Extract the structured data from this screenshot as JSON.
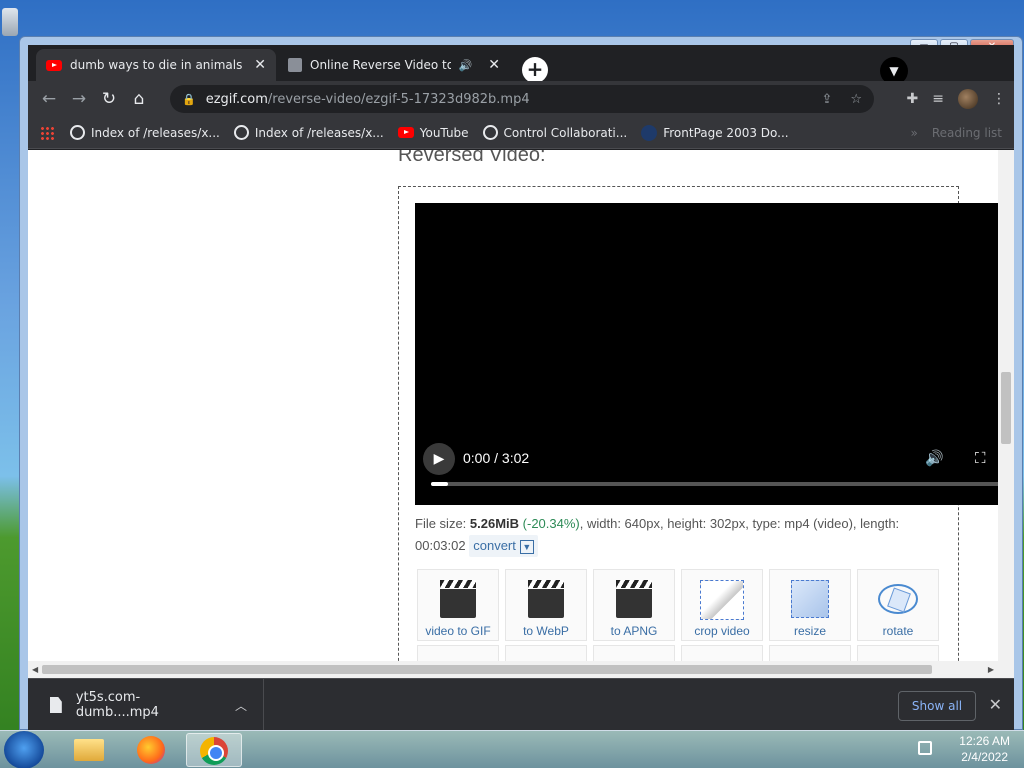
{
  "window": {
    "minimize": "▭",
    "maximize": "▢",
    "close": "✕"
  },
  "tabs": [
    {
      "title": "dumb ways to die in animals reve",
      "close": "✕"
    },
    {
      "title": "Online Reverse Video tool",
      "close": "✕",
      "audio": "🔊"
    }
  ],
  "toolbar": {
    "back": "←",
    "forward": "→",
    "reload": "↻",
    "home": "⌂",
    "url_host": "ezgif.com",
    "url_path": "/reverse-video/ezgif-5-17323d982b.mp4"
  },
  "bookmarks": [
    {
      "label": "Index of /releases/x...",
      "icon": "globe-icon"
    },
    {
      "label": "Index of /releases/x...",
      "icon": "globe-icon"
    },
    {
      "label": "YouTube",
      "icon": "youtube-icon"
    },
    {
      "label": "Control Collaborati...",
      "icon": "globe-icon"
    },
    {
      "label": "FrontPage 2003 Do...",
      "icon": "frontpage-icon"
    }
  ],
  "bookmarks_more": "»",
  "reading_list": "Reading list",
  "page": {
    "heading": "Reversed Video:",
    "video": {
      "time": "0:00 / 3:02",
      "progress": 0.03
    },
    "info": {
      "prefix": "File size: ",
      "size": "5.26MiB",
      "pct": "(-20.34%)",
      "rest": ", width: 640px, height: 302px, type: mp4 (video), length: 00:03:02",
      "convert": "convert"
    },
    "tools": [
      "video to GIF",
      "to WebP",
      "to APNG",
      "crop video",
      "resize",
      "rotate"
    ]
  },
  "download": {
    "file": "yt5s.com-dumb....mp4",
    "show_all": "Show all",
    "close": "✕"
  },
  "taskbar": {
    "time": "12:26 AM",
    "date": "2/4/2022"
  },
  "colors": {
    "accent": "#8ab4f8",
    "chrome_dark": "#202124",
    "tab_active": "#35363a",
    "pct_green": "#2e8b57"
  }
}
